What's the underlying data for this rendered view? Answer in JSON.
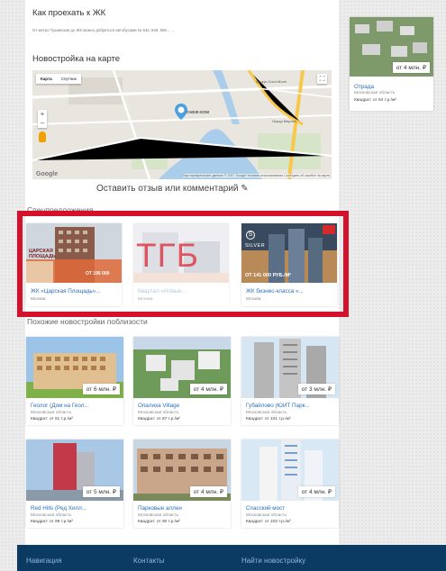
{
  "how_to_get": {
    "title": "Как проехать к ЖК",
    "text": "От метро Тушинская до ЖК можно добраться автобусами № 542, 549, 568... →"
  },
  "map_section": {
    "title": "Новостройка на карте",
    "map_type": [
      "Карта",
      "Спутник"
    ],
    "pin_label": "СНЕЖ-КОМ",
    "labels": [
      "Крокус Сити Молл",
      "Лерца Мерлен"
    ],
    "google": "Google",
    "footer": "Картографические данные © 2017 Google   Условия использования   Сообщить об ошибке на карте"
  },
  "review_link": "Оставить отзыв или комментарий ✎",
  "recommended": {
    "title": "Спецпредложения",
    "overlay": "ТГБ",
    "cards": [
      {
        "name": "ЖК «Царская Площадь»...",
        "region": "Москва",
        "img_text": "ЦАРСКАЯ ПЛОЩАДЬ",
        "promo": "ОТ 195 000"
      },
      {
        "name": "Квартал «Новые...",
        "region": "Москва",
        "img_text": "",
        "promo": ""
      },
      {
        "name": "ЖК бизнес-класса «...",
        "region": "Москва",
        "img_text": "SILVER",
        "promo": "ОТ 141 000 РУБ./М²"
      }
    ]
  },
  "similar": {
    "title": "Похожие новостройки поблизости",
    "cards": [
      {
        "name": "Геолог (Дом на Геол...",
        "region": "Московская область",
        "price": "Квадрат: от 91 т.р./м²",
        "tag": "от 6 млн. ₽"
      },
      {
        "name": "Опалиха Village",
        "region": "Московская область",
        "price": "Квадрат: от 87 т.р./м²",
        "tag": "от 4 млн. ₽"
      },
      {
        "name": "Губайлово (ЮИТ Парк...",
        "region": "Московская область",
        "price": "Квадрат: от 101 т.р./м²",
        "tag": "от 3 млн. ₽"
      },
      {
        "name": "Red Hills (Ред Хилл...",
        "region": "Московская область",
        "price": "Квадрат: от 99 т.р./м²",
        "tag": "от 5 млн. ₽"
      },
      {
        "name": "Парковые аллеи",
        "region": "Московская область",
        "price": "Квадрат: от 90 т.р./м²",
        "tag": "от 4 млн. ₽"
      },
      {
        "name": "Спасский мост",
        "region": "Московская область",
        "price": "Квадрат: от 103 т.р./м²",
        "tag": "от 4 млн. ₽"
      }
    ]
  },
  "side_card": {
    "name": "Отрада",
    "region": "Московская область",
    "price": "Квадрат: от 84 т.р./м²",
    "tag": "от 4 млн. ₽"
  },
  "footer": {
    "nav": [
      "Навигация",
      "Контакты",
      "Найти новостройку"
    ]
  },
  "colors": {
    "accent": "#2a6fb8",
    "frame": "#d4112b",
    "footer": "#0b3a63"
  }
}
